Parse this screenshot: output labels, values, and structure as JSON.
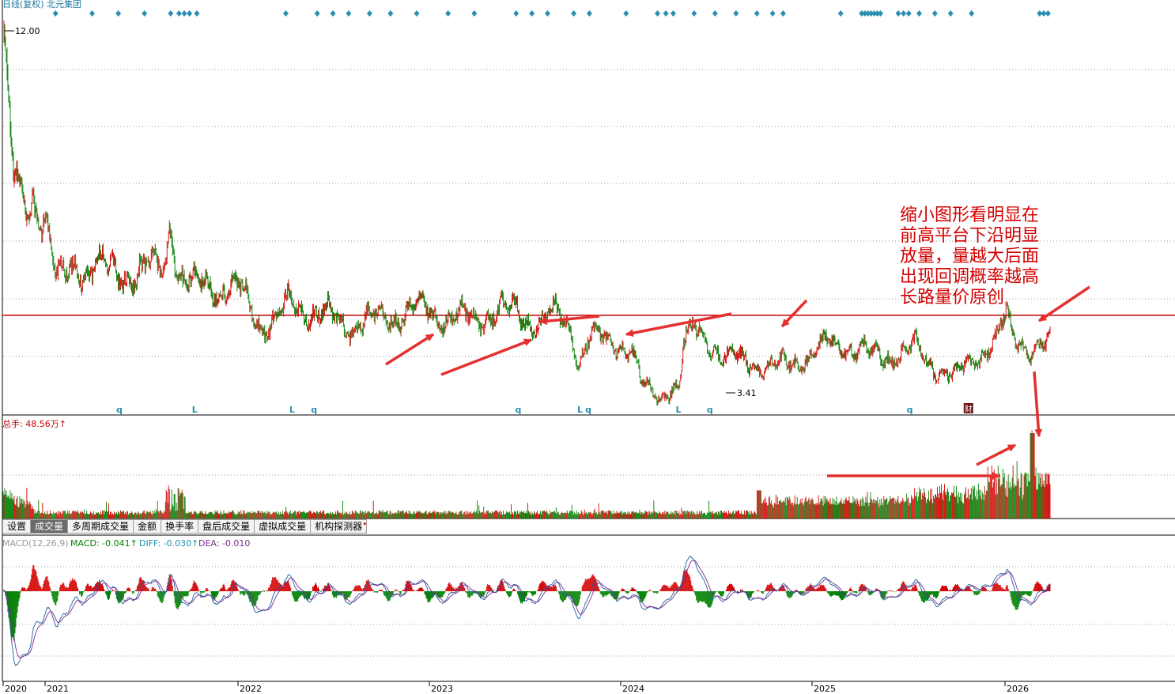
{
  "header": {
    "title": "日线(复权) 北元集团"
  },
  "price_panel": {
    "high_label": "12.00",
    "low_label": "3.41"
  },
  "volume_panel": {
    "label": "总手: 48.56万↑"
  },
  "tabs": [
    {
      "label": "设置"
    },
    {
      "label": "成交量"
    },
    {
      "label": "多周期成交量"
    },
    {
      "label": "金额"
    },
    {
      "label": "换手率"
    },
    {
      "label": "盘后成交量"
    },
    {
      "label": "虚拟成交量"
    },
    {
      "label": "机构探测器"
    }
  ],
  "active_tab": 1,
  "macd_panel": {
    "name": "MACD(12,26,9)",
    "macd": "MACD: -0.041↑",
    "diff": "DIFF: -0.030↑",
    "dea": "DEA: -0.010"
  },
  "annotation": {
    "lines": [
      "缩小图形看明显在",
      "前高平台下沿明显",
      "放量，量越大后面",
      "出现回调概率越高",
      "长路量价原创"
    ]
  },
  "event_markers": [
    {
      "label": "q",
      "x": 0.111
    },
    {
      "label": "L",
      "x": 0.183
    },
    {
      "label": "L",
      "x": 0.276
    },
    {
      "label": "q",
      "x": 0.297
    },
    {
      "label": "q",
      "x": 0.492
    },
    {
      "label": "L",
      "x": 0.551
    },
    {
      "label": "q",
      "x": 0.559
    },
    {
      "label": "L",
      "x": 0.645
    },
    {
      "label": "q",
      "x": 0.675
    },
    {
      "label": "q",
      "x": 0.866
    },
    {
      "label": "财",
      "x": 0.922
    }
  ],
  "colors": {
    "up": "#d40000",
    "down": "#008000",
    "diff": "#1f5fa0",
    "dea": "#7a2a8a",
    "resistance": "#c00000",
    "marker": "#2a8fb0",
    "grid": "#9a9a9a"
  },
  "chart_data": {
    "type": "candlestick",
    "x_range": [
      "2020-02",
      "2026-03"
    ],
    "x_ticks": [
      "2020",
      "2021",
      "2022",
      "2023",
      "2024",
      "2025",
      "2026"
    ],
    "price": {
      "ylim": [
        3.2,
        12.6
      ],
      "highest": 12.0,
      "lowest": 3.41,
      "resistance_level": 5.45,
      "anchors": [
        [
          0,
          12.0
        ],
        [
          0.01,
          8.6
        ],
        [
          0.02,
          8.0
        ],
        [
          0.03,
          8.2
        ],
        [
          0.045,
          7.3
        ],
        [
          0.05,
          6.2
        ],
        [
          0.06,
          6.4
        ],
        [
          0.07,
          6.7
        ],
        [
          0.08,
          6.5
        ],
        [
          0.09,
          6.6
        ],
        [
          0.1,
          6.5
        ],
        [
          0.12,
          6.4
        ],
        [
          0.14,
          6.5
        ],
        [
          0.155,
          6.7
        ],
        [
          0.16,
          7.9
        ],
        [
          0.165,
          6.6
        ],
        [
          0.175,
          6.1
        ],
        [
          0.19,
          6.2
        ],
        [
          0.21,
          6.1
        ],
        [
          0.23,
          6.0
        ],
        [
          0.235,
          5.6
        ],
        [
          0.25,
          5.2
        ],
        [
          0.26,
          5.3
        ],
        [
          0.272,
          5.7
        ],
        [
          0.29,
          5.6
        ],
        [
          0.31,
          5.4
        ],
        [
          0.33,
          5.2
        ],
        [
          0.35,
          5.35
        ],
        [
          0.37,
          5.4
        ],
        [
          0.39,
          5.6
        ],
        [
          0.41,
          5.5
        ],
        [
          0.43,
          5.45
        ],
        [
          0.45,
          5.3
        ],
        [
          0.47,
          5.6
        ],
        [
          0.49,
          5.5
        ],
        [
          0.51,
          5.3
        ],
        [
          0.525,
          5.45
        ],
        [
          0.54,
          5.2
        ],
        [
          0.55,
          4.4
        ],
        [
          0.56,
          5.0
        ],
        [
          0.575,
          4.8
        ],
        [
          0.6,
          4.7
        ],
        [
          0.61,
          3.8
        ],
        [
          0.625,
          3.5
        ],
        [
          0.638,
          3.8
        ],
        [
          0.645,
          3.7
        ],
        [
          0.65,
          4.7
        ],
        [
          0.66,
          5.1
        ],
        [
          0.67,
          5.0
        ],
        [
          0.69,
          4.4
        ],
        [
          0.71,
          4.4
        ],
        [
          0.73,
          4.2
        ],
        [
          0.75,
          4.3
        ],
        [
          0.77,
          4.5
        ],
        [
          0.79,
          4.8
        ],
        [
          0.81,
          4.7
        ],
        [
          0.83,
          4.5
        ],
        [
          0.85,
          4.5
        ],
        [
          0.87,
          4.7
        ],
        [
          0.89,
          4.2
        ],
        [
          0.91,
          4.0
        ],
        [
          0.93,
          4.5
        ],
        [
          0.95,
          4.9
        ],
        [
          0.958,
          5.4
        ],
        [
          0.965,
          4.9
        ],
        [
          0.98,
          4.7
        ],
        [
          1.0,
          4.7
        ]
      ]
    },
    "volume": {
      "ylim": [
        0,
        48.56
      ],
      "unit": "万手",
      "last_total": 48.56
    },
    "macd": {
      "params": [
        12,
        26,
        9
      ],
      "last_macd": -0.041,
      "last_diff": -0.03,
      "last_dea": -0.01
    }
  }
}
